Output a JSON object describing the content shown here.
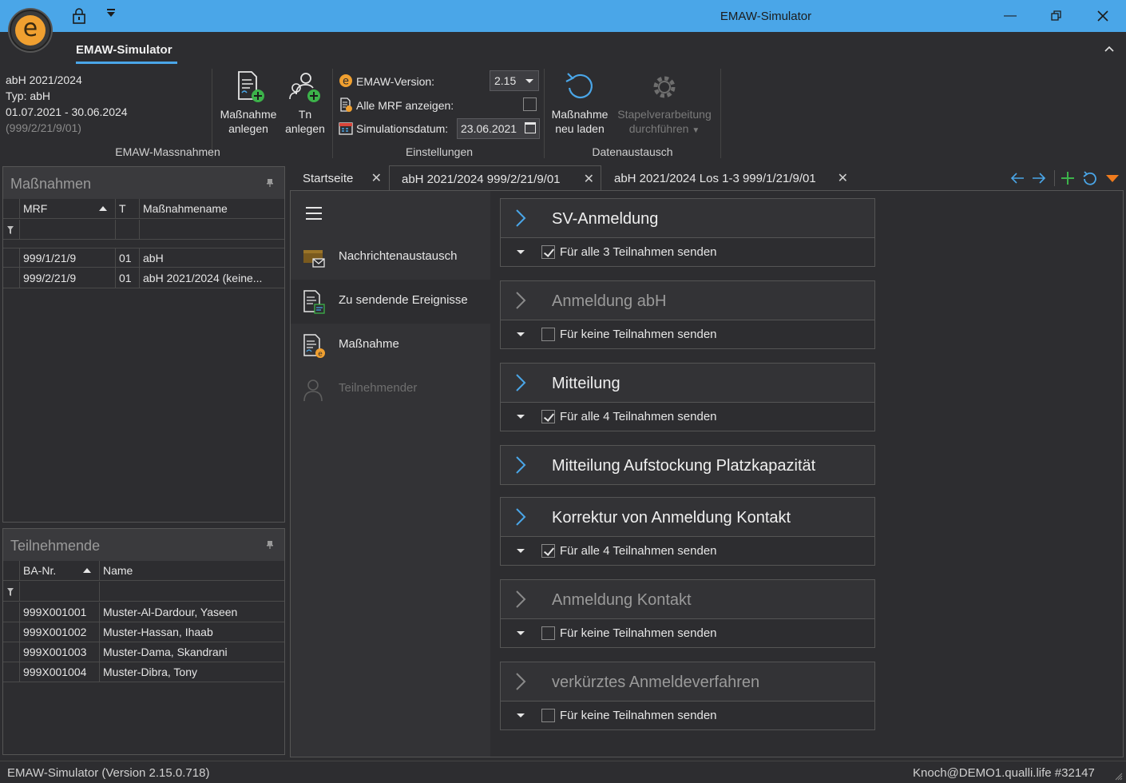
{
  "window": {
    "title": "EMAW-Simulator"
  },
  "ribbon": {
    "tab_label": "EMAW-Simulator",
    "info": {
      "line1": "abH 2021/2024",
      "line2": "Typ: abH",
      "line3": "01.07.2021 - 30.06.2024",
      "line4": "(999/2/21/9/01)"
    },
    "groups": {
      "massnahmen": {
        "label": "EMAW-Massnahmen",
        "btn_massnahme_l1": "Maßnahme",
        "btn_massnahme_l2": "anlegen",
        "btn_tn_l1": "Tn",
        "btn_tn_l2": "anlegen"
      },
      "einstellungen": {
        "label": "Einstellungen",
        "version_label": "EMAW-Version:",
        "version_value": "2.15",
        "mrf_label": "Alle MRF anzeigen:",
        "date_label": "Simulationsdatum:",
        "date_value": "23.06.2021"
      },
      "datenaustausch": {
        "label": "Datenaustausch",
        "btn_reload_l1": "Maßnahme",
        "btn_reload_l2": "neu laden",
        "btn_batch_l1": "Stapelverarbeitung",
        "btn_batch_l2": "durchführen"
      }
    }
  },
  "massnahmen_panel": {
    "title": "Maßnahmen",
    "columns": [
      "MRF",
      "T",
      "Maßnahmename"
    ],
    "rows": [
      [
        "999/1/21/9",
        "01",
        "abH"
      ],
      [
        "999/2/21/9",
        "01",
        "abH 2021/2024 (keine..."
      ]
    ]
  },
  "teilnehmende_panel": {
    "title": "Teilnehmende",
    "columns": [
      "BA-Nr.",
      "Name"
    ],
    "rows": [
      [
        "999X001001",
        "Muster-Al-Dardour, Yaseen"
      ],
      [
        "999X001002",
        "Muster-Hassan, Ihaab"
      ],
      [
        "999X001003",
        "Muster-Dama, Skandrani"
      ],
      [
        "999X001004",
        "Muster-Dibra, Tony"
      ]
    ]
  },
  "doc_tabs": [
    {
      "label": "Startseite"
    },
    {
      "label": "abH 2021/2024 999/2/21/9/01"
    },
    {
      "label": "abH 2021/2024 Los 1-3 999/1/21/9/01"
    }
  ],
  "nav": {
    "items": [
      {
        "label": "Nachrichtenaustausch"
      },
      {
        "label": "Zu sendende Ereignisse"
      },
      {
        "label": "Maßnahme"
      },
      {
        "label": "Teilnehmender"
      }
    ]
  },
  "events": [
    {
      "title": "SV-Anmeldung",
      "option": "Für alle 3 Teilnahmen senden",
      "checked": true
    },
    {
      "title": "Anmeldung abH",
      "option": "Für keine Teilnahmen senden",
      "checked": false
    },
    {
      "title": "Mitteilung",
      "option": "Für alle 4 Teilnahmen senden",
      "checked": true
    },
    {
      "title": "Mitteilung Aufstockung Platzkapazität"
    },
    {
      "title": "Korrektur von Anmeldung Kontakt",
      "option": "Für alle 4 Teilnahmen senden",
      "checked": true
    },
    {
      "title": "Anmeldung Kontakt",
      "option": "Für keine Teilnahmen senden",
      "checked": false
    },
    {
      "title": "verkürztes Anmeldeverfahren",
      "option": "Für keine Teilnahmen senden",
      "checked": false
    }
  ],
  "status": {
    "version": "EMAW-Simulator (Version 2.15.0.718)",
    "user": "Knoch@DEMO1.qualli.life  #32147"
  },
  "colors": {
    "accent": "#4aa6e8",
    "logo": "#f0a030",
    "green": "#3cb34a",
    "orange": "#f07b1d"
  }
}
